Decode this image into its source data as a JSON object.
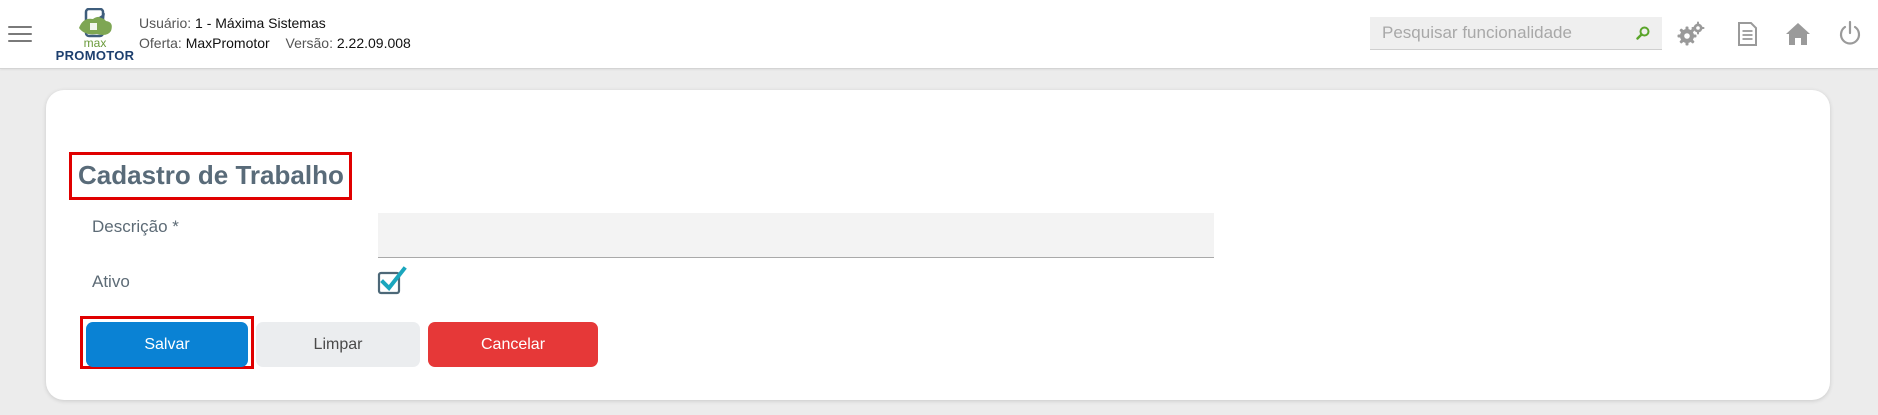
{
  "header": {
    "logo": {
      "line1": "max",
      "line2": "PROMOTOR"
    },
    "user_label": "Usuário:",
    "user_value": "1 - Máxima Sistemas",
    "offer_label": "Oferta:",
    "offer_value": "MaxPromotor",
    "version_label": "Versão:",
    "version_value": "2.22.09.008",
    "search": {
      "placeholder": "Pesquisar funcionalidade",
      "value": ""
    },
    "icons": [
      "menu-icon",
      "search-icon",
      "gears-icon",
      "document-icon",
      "home-icon",
      "power-icon"
    ]
  },
  "form": {
    "title": "Cadastro de Trabalho",
    "description_label": "Descrição *",
    "description_value": "",
    "active_label": "Ativo",
    "active_checked": true
  },
  "buttons": {
    "save": "Salvar",
    "clear": "Limpar",
    "cancel": "Cancelar"
  },
  "colors": {
    "primary": "#0a82d4",
    "danger": "#e63838",
    "highlight": "#e00000",
    "checkbox": "#1a9bb0",
    "title": "#596b79"
  }
}
